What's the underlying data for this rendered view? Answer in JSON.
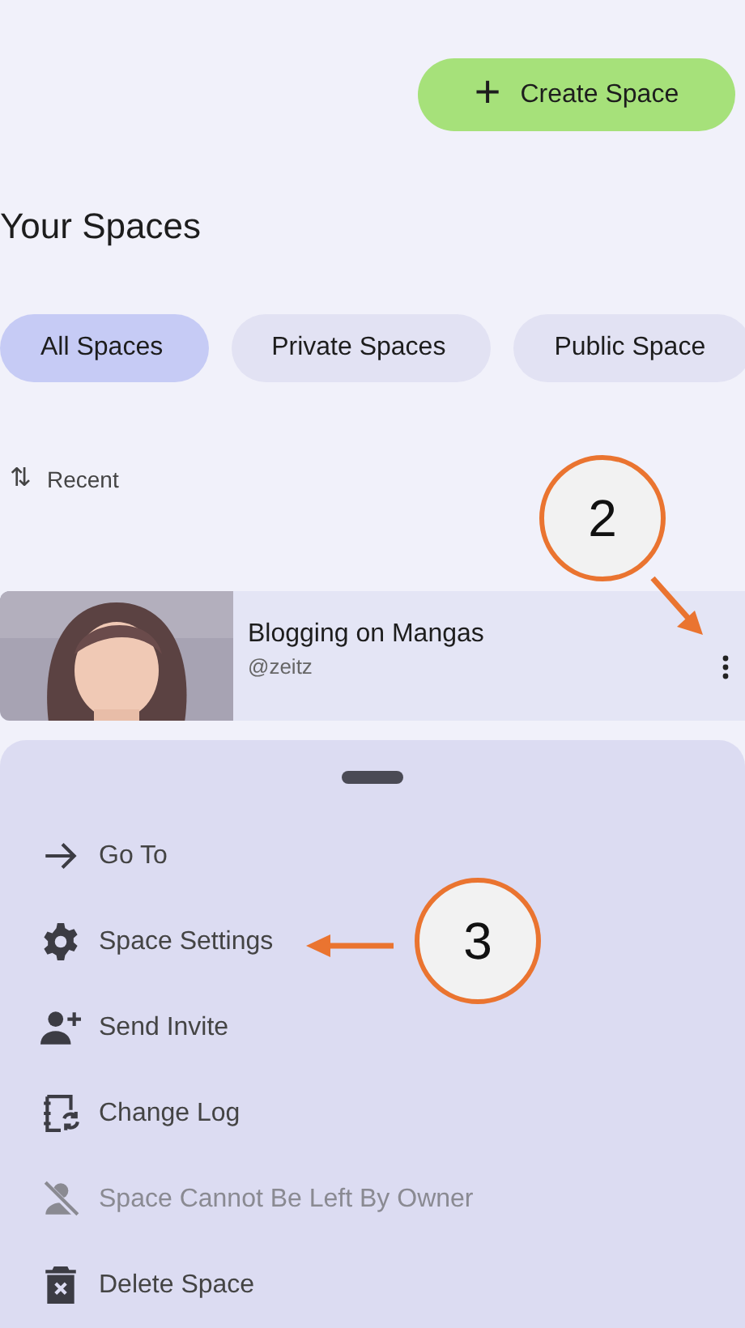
{
  "create_button": {
    "icon": "+",
    "label": "Create Space"
  },
  "title": "Your Spaces",
  "filters": [
    {
      "label": "All Spaces",
      "selected": true
    },
    {
      "label": "Private Spaces",
      "selected": false
    },
    {
      "label": "Public Space",
      "selected": false
    }
  ],
  "sort": {
    "icon": "⇅",
    "label": "Recent"
  },
  "spaces": [
    {
      "title": "Blogging on Mangas",
      "owner": "@zeitz"
    }
  ],
  "sheet": {
    "items": [
      {
        "kind": "goto",
        "label": "Go To",
        "disabled": false
      },
      {
        "kind": "settings",
        "label": "Space Settings",
        "disabled": false
      },
      {
        "kind": "invite",
        "label": "Send Invite",
        "disabled": false
      },
      {
        "kind": "log",
        "label": "Change Log",
        "disabled": false
      },
      {
        "kind": "leave",
        "label": "Space Cannot Be Left By Owner",
        "disabled": true
      },
      {
        "kind": "delete",
        "label": "Delete Space",
        "disabled": false
      }
    ]
  },
  "annotations": [
    {
      "label": "2"
    },
    {
      "label": "3"
    }
  ]
}
